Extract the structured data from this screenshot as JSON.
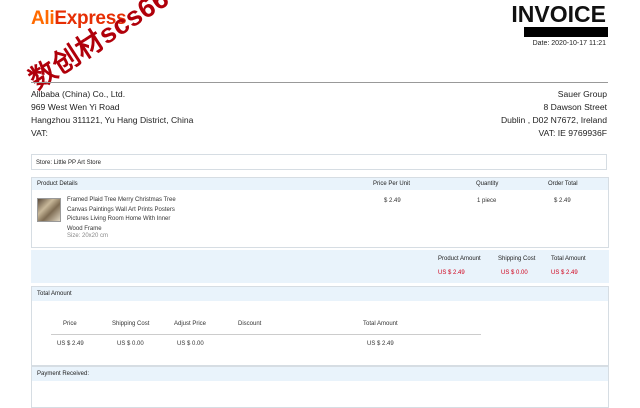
{
  "logo": {
    "part1": "Ali",
    "part2": "Express"
  },
  "watermark": "数创材scs66",
  "invoice": {
    "title": "INVOICE",
    "date": "Date: 2020-10-17 11:21"
  },
  "seller": {
    "line1": "Alibaba (China) Co., Ltd.",
    "line2": "969 West Wen Yi Road",
    "line3": "Hangzhou 311121, Yu Hang District, China",
    "line4": "VAT:"
  },
  "buyer": {
    "line1": "Sauer Group",
    "line2": "8 Dawson Street",
    "line3": "Dublin , D02 N7672, Ireland",
    "line4": "VAT: IE 9769936F"
  },
  "store": "Store: Little PP Art Store",
  "product_table": {
    "headers": {
      "details": "Product Details",
      "price": "Price Per Unit",
      "quantity": "Quantity",
      "total": "Order Total"
    },
    "item": {
      "name": "Framed Plaid Tree Merry Christmas Tree Canvas Paintings Wall Art Prints Posters Pictures Living Room Home With Inner Wood Frame",
      "size": "Size: 20x20 cm",
      "price": "$ 2.49",
      "quantity": "1 piece",
      "total": "$ 2.49"
    }
  },
  "amounts": {
    "product_label": "Product Amount",
    "shipping_label": "Shipping Cost",
    "total_label": "Total Amount",
    "product_value": "US $ 2.49",
    "shipping_value": "US $ 0.00",
    "total_value": "US $ 2.49"
  },
  "total_amount": {
    "title": "Total Amount",
    "headers": {
      "price": "Price",
      "shipping": "Shipping Cost",
      "adjust": "Adjust Price",
      "discount": "Discount",
      "total": "Total Amount"
    },
    "values": {
      "price": "US $ 2.49",
      "shipping": "US $ 0.00",
      "adjust": "US $ 0.00",
      "total": "US $ 2.49"
    }
  },
  "payment": {
    "title": "Payment Received:"
  }
}
